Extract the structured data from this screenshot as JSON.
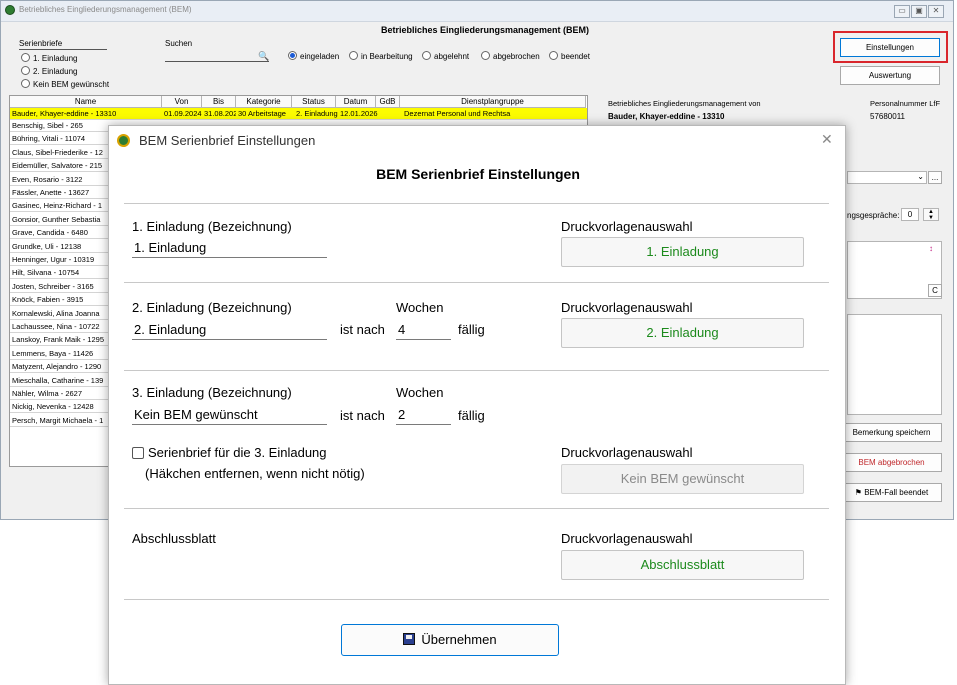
{
  "window": {
    "title": "Betriebliches Eingliederungsmanagement (BEM)",
    "header": "Betriebliches Eingliederungsmanagement (BEM)",
    "controls": [
      "▭",
      "▣",
      "✕"
    ]
  },
  "serienbriefe": {
    "label": "Serienbriefe",
    "options": [
      "1. Einladung",
      "2. Einladung",
      "Kein BEM gewünscht"
    ]
  },
  "search": {
    "label": "Suchen",
    "value": ""
  },
  "status_filters": [
    "eingeladen",
    "in Bearbeitung",
    "abgelehnt",
    "abgebrochen",
    "beendet"
  ],
  "status_selected": "eingeladen",
  "buttons": {
    "einstellungen": "Einstellungen",
    "auswertung": "Auswertung",
    "bemerkung_speichern": "Bemerkung speichern",
    "bem_abgebrochen": "BEM abgebrochen",
    "bem_beendet": "BEM-Fall beendet",
    "dropdown_more": "...",
    "c_button": "C"
  },
  "table": {
    "columns": [
      "Name",
      "Von",
      "Bis",
      "Kategorie",
      "Status",
      "Datum",
      "GdB",
      "Dienstplangruppe"
    ],
    "selected_row": [
      "Bauder, Khayer-eddine - 13310",
      "01.09.2024",
      "31.08.2025",
      "30 Arbeitstage",
      "2. Einladung",
      "12.01.2026",
      "",
      "Dezernat Personal und Rechtsa"
    ],
    "rows": [
      "Benschig, Sibel - 265",
      "Bühring, Vitali - 11074",
      "Claus, Sibel-Friederike - 12",
      "Eidemüller, Salvatore - 215",
      "Even, Rosario - 3122",
      "Fässler, Anette - 13627",
      "Gasinec, Heinz-Richard - 1",
      "Gonsior, Gunther Sebastia",
      "Grave, Candida - 6480",
      "Grundke, Uli - 12138",
      "Henninger, Ugur - 10319",
      "Hilt, Silvana - 10754",
      "Josten, Schreiber - 3165",
      "Knöck, Fabien - 3915",
      "Kornalewski, Alina Joanna",
      "Lachaussee, Nina - 10722",
      "Lanskoy, Frank Maik - 1295",
      "Lemmens, Baya - 11426",
      "Matyzent, Alejandro - 1290",
      "Mieschalla, Catharine - 139",
      "Nähler, Wilma - 2627",
      "Nickig, Nevenka - 12428",
      "Persch, Margit Michaela - 1"
    ]
  },
  "right_panel": {
    "label": "Betriebliches Eingliederungsmanagement von",
    "person": "Bauder, Khayer-eddine - 13310",
    "pn_label": "Personalnummer LfF",
    "pn_value": "57680011",
    "gespraeche_label": "ngsgespräche:",
    "gespraeche_value": "0"
  },
  "dialog": {
    "title": "BEM Serienbrief Einstellungen",
    "heading": "BEM Serienbrief Einstellungen",
    "close": "✕",
    "rows": [
      {
        "label": "1. Einladung (Bezeichnung)",
        "value": "1. Einladung",
        "template_label": "Druckvorlagenauswahl",
        "template_button": "1. Einladung"
      },
      {
        "label": "2. Einladung (Bezeichnung)",
        "value": "2. Einladung",
        "weeks_label": "Wochen",
        "ist_nach": "ist nach",
        "weeks": "4",
        "faellig": "fällig",
        "template_label": "Druckvorlagenauswahl",
        "template_button": "2. Einladung"
      },
      {
        "label": "3. Einladung (Bezeichnung)",
        "value": "Kein BEM gewünscht",
        "weeks_label": "Wochen",
        "ist_nach": "ist nach",
        "weeks": "2",
        "faellig": "fällig",
        "template_label": "Druckvorlagenauswahl",
        "template_button": "Kein BEM gewünscht"
      }
    ],
    "checkbox_label": "Serienbrief für die 3. Einladung",
    "checkbox_hint": "(Häkchen entfernen, wenn nicht nötig)",
    "abschluss_label": "Abschlussblatt",
    "abschluss_template_label": "Druckvorlagenauswahl",
    "abschluss_button": "Abschlussblatt",
    "apply_button": "Übernehmen"
  },
  "colors": {
    "selection": "#fcfc00",
    "highlight_frame": "#d9262c",
    "template_text": "#1c8a1c"
  }
}
